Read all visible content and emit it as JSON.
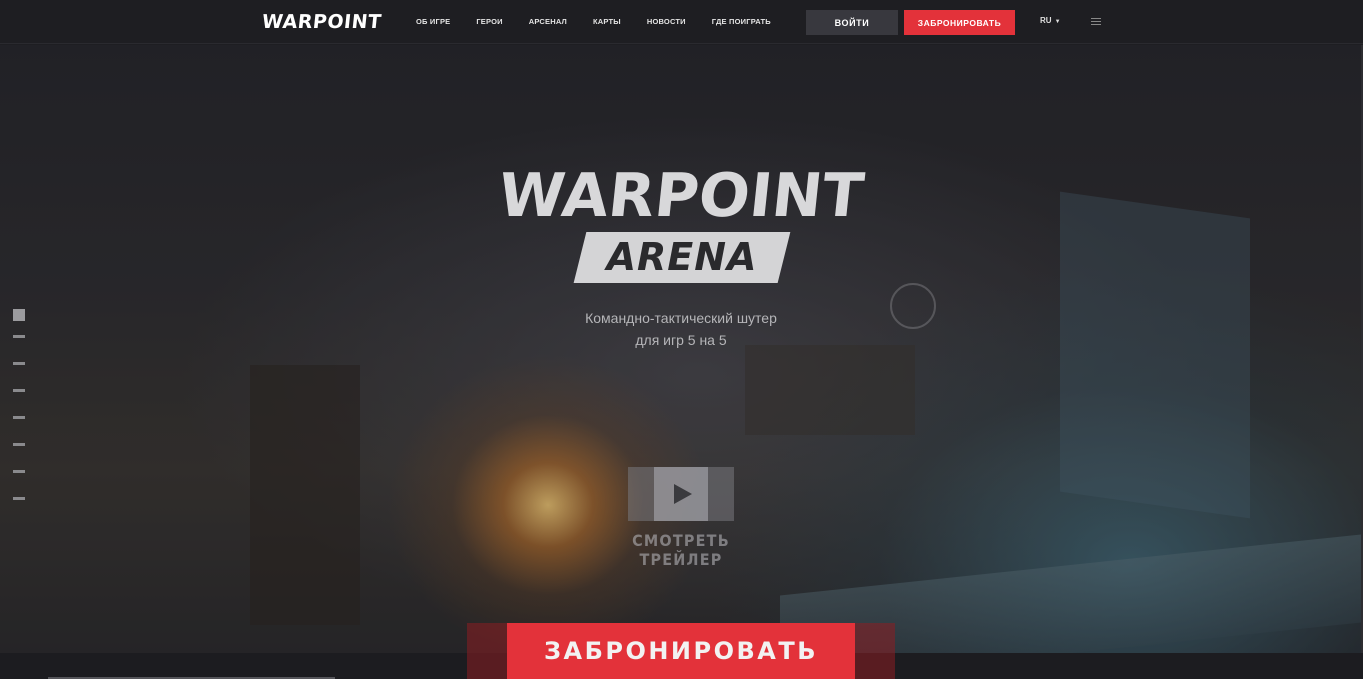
{
  "header": {
    "logo": "WARPOINT",
    "nav": [
      "ОБ ИГРЕ",
      "ГЕРОИ",
      "АРСЕНАЛ",
      "КАРТЫ",
      "НОВОСТИ",
      "ГДЕ ПОИГРАТЬ"
    ],
    "login_label": "ВОЙТИ",
    "book_label": "ЗАБРОНИРОВАТЬ",
    "language": "RU",
    "menu_icon": "hamburger-icon"
  },
  "hero": {
    "logo": "WARPOINT",
    "sublogo": "ARENA",
    "tagline_line1": "Командно-тактический шутер",
    "tagline_line2": "для игр 5 на 5",
    "trailer_label": "СМОТРЕТЬ ТРЕЙЛЕР",
    "cta_label": "ЗАБРОНИРОВАТЬ",
    "pager_count": 8,
    "pager_active": 1
  },
  "colors": {
    "accent": "#e3323a",
    "background": "#1e1e22",
    "login_bg": "#38383e"
  }
}
